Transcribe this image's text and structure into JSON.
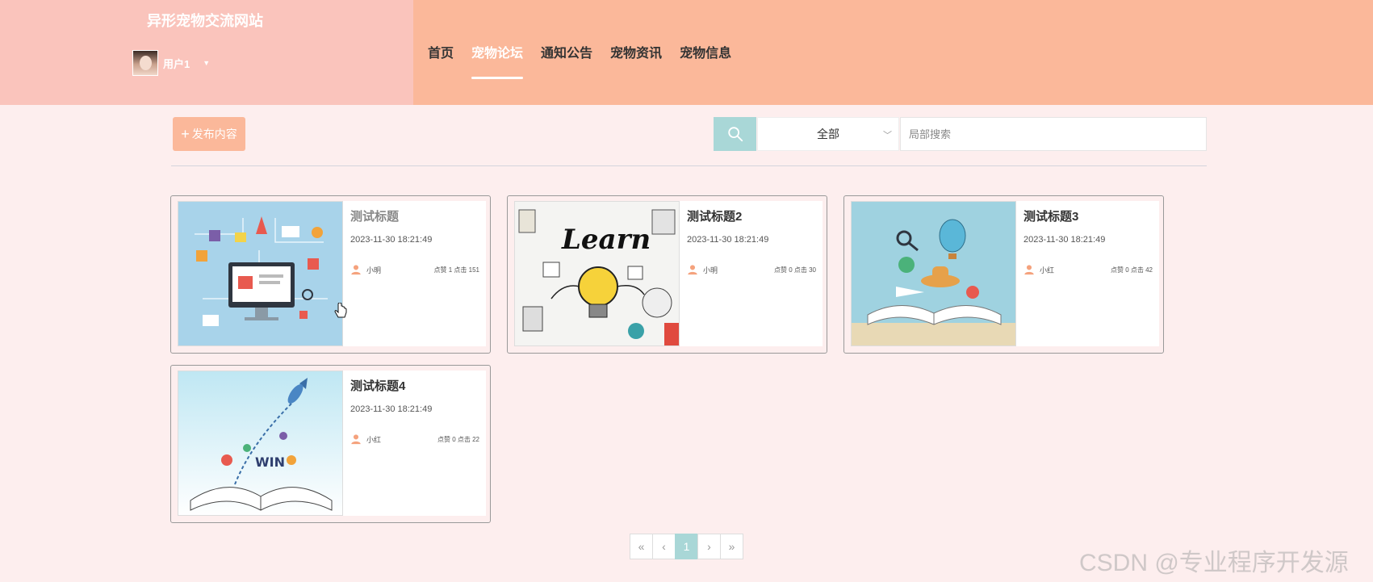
{
  "header": {
    "site_title": "异形宠物交流网站",
    "user_name": "用户1",
    "nav": [
      {
        "label": "首页",
        "active": false
      },
      {
        "label": "宠物论坛",
        "active": true
      },
      {
        "label": "通知公告",
        "active": false
      },
      {
        "label": "宠物资讯",
        "active": false
      },
      {
        "label": "宠物信息",
        "active": false
      }
    ]
  },
  "toolbar": {
    "publish_label": "发布内容",
    "select_value": "全部",
    "search_placeholder": "局部搜索"
  },
  "posts": [
    {
      "title": "测试标题",
      "time": "2023-11-30 18:21:49",
      "author": "小明",
      "stats": "点赞 1 点击 151",
      "image": "computer-shopping-illustration"
    },
    {
      "title": "测试标题2",
      "time": "2023-11-30 18:21:49",
      "author": "小明",
      "stats": "点赞 0 点击 30",
      "image": "learn-lightbulb-illustration"
    },
    {
      "title": "测试标题3",
      "time": "2023-11-30 18:21:49",
      "author": "小红",
      "stats": "点赞 0 点击 42",
      "image": "open-book-travel-illustration"
    },
    {
      "title": "测试标题4",
      "time": "2023-11-30 18:21:49",
      "author": "小红",
      "stats": "点赞 0 点击 22",
      "image": "book-rocket-illustration"
    }
  ],
  "pagination": {
    "first": "«",
    "prev": "‹",
    "current": "1",
    "next": "›",
    "last": "»"
  },
  "watermark": "CSDN @专业程序开发源",
  "colors": {
    "header_bg": "#fbb89a",
    "header_left_bg": "#fac4bc",
    "page_bg": "#fdeeee",
    "accent_teal": "#a9d7d7"
  }
}
